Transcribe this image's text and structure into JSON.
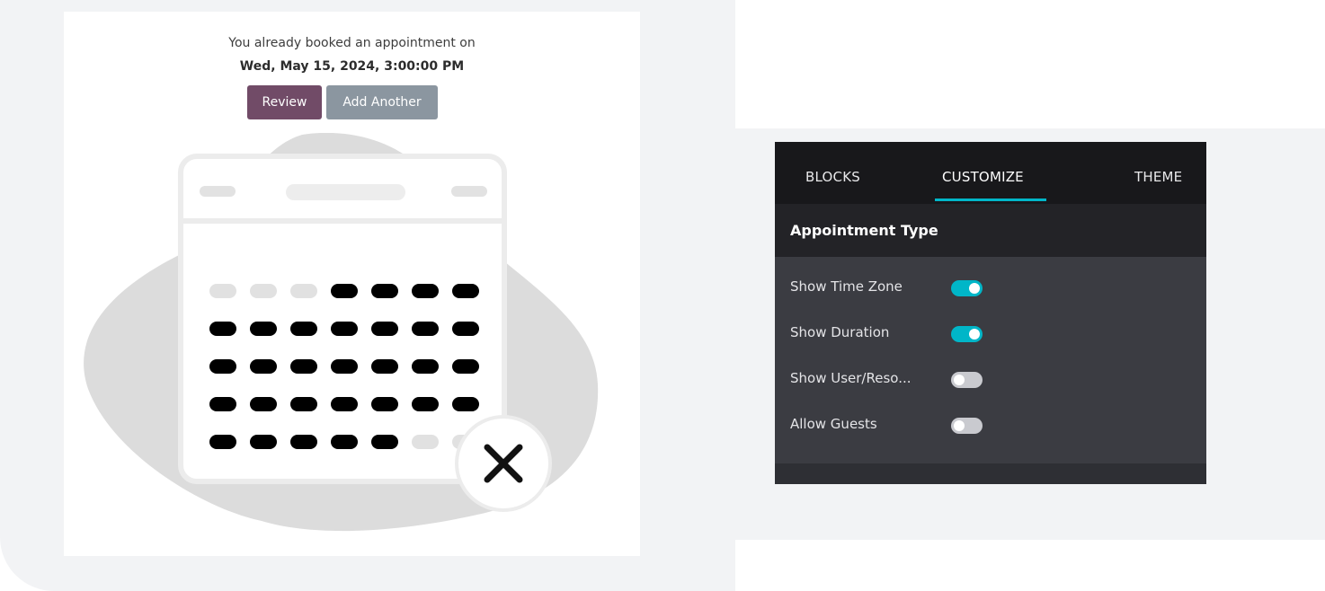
{
  "appointment_card": {
    "message": "You already booked an appointment on",
    "date": "Wed, May 15, 2024, 3:00:00 PM",
    "review_label": "Review",
    "add_another_label": "Add Another"
  },
  "editor_panel": {
    "tabs": [
      {
        "label": "BLOCKS",
        "active": false
      },
      {
        "label": "CUSTOMIZE",
        "active": true
      },
      {
        "label": "THEME",
        "active": false
      }
    ],
    "section_title": "Appointment Type",
    "options": [
      {
        "label": "Show Time Zone",
        "enabled": true
      },
      {
        "label": "Show Duration",
        "enabled": true
      },
      {
        "label": "Show User/Reso...",
        "enabled": false
      },
      {
        "label": "Allow Guests",
        "enabled": false
      }
    ]
  },
  "colors": {
    "review_button": "#714b67",
    "add_another_button": "#8b96a0",
    "accent": "#00b6c8"
  }
}
